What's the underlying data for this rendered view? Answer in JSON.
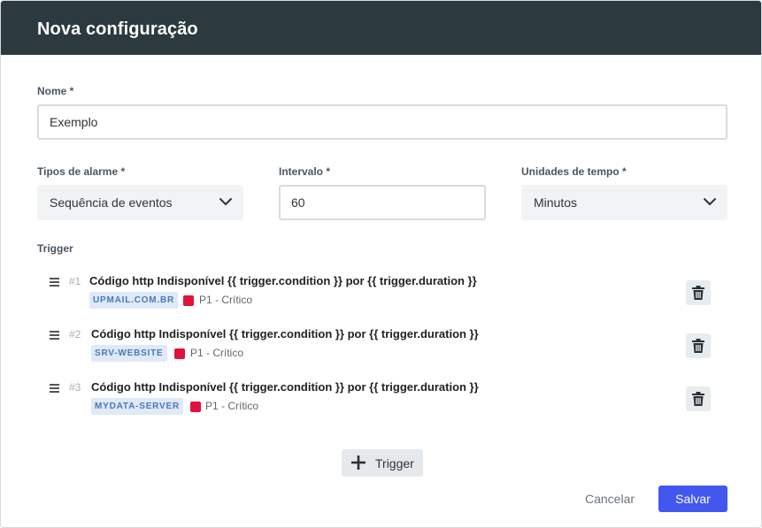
{
  "dialog": {
    "title": "Nova configuração"
  },
  "form": {
    "name_label": "Nome *",
    "name_value": "Exemplo",
    "alarm_type_label": "Tipos de alarme *",
    "alarm_type_value": "Sequência de eventos",
    "interval_label": "Intervalo *",
    "interval_value": "60",
    "time_units_label": "Unidades de tempo *",
    "time_units_value": "Minutos",
    "trigger_label": "Trigger"
  },
  "triggers": [
    {
      "number": "#1",
      "title": "Código http Indisponível {{ trigger.condition }} por {{ trigger.duration }}",
      "host": "UPMAIL.COM.BR",
      "priority": "P1 - Crítico"
    },
    {
      "number": "#2",
      "title": "Código http Indisponível {{ trigger.condition }} por {{ trigger.duration }}",
      "host": "SRV-WEBSITE",
      "priority": "P1 - Crítico"
    },
    {
      "number": "#3",
      "title": "Código http Indisponível {{ trigger.condition }} por {{ trigger.duration }}",
      "host": "MYDATA-SERVER",
      "priority": "P1 - Crítico"
    }
  ],
  "actions": {
    "add_trigger_label": "Trigger",
    "cancel_label": "Cancelar",
    "save_label": "Salvar"
  },
  "colors": {
    "header_bg": "#2c3a3f",
    "primary": "#4257ee",
    "priority_critical": "#e0123c",
    "tag_bg": "#dfe9f7",
    "tag_text": "#4a79b8"
  },
  "icons": {
    "drag": "drag-handle-icon",
    "delete": "trash-icon",
    "dropdown": "chevron-down-icon",
    "add": "plus-icon"
  }
}
